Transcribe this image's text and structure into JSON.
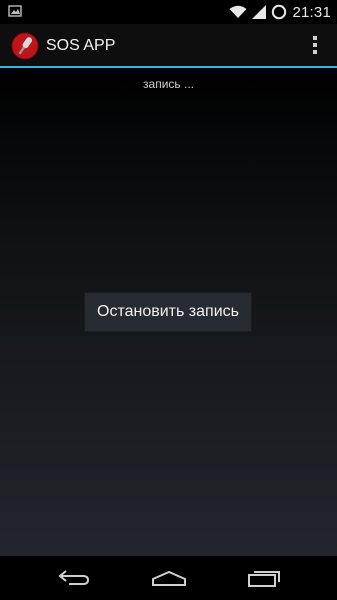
{
  "status_bar": {
    "time": "21:31",
    "icons": [
      "image-notification-icon",
      "wifi-icon",
      "signal-icon",
      "battery-icon"
    ]
  },
  "action_bar": {
    "title": "SOS APP",
    "app_icon": "microphone-icon",
    "overflow_icon": "overflow-menu-icon"
  },
  "main": {
    "status_text": "запись ...",
    "stop_button_label": "Остановить запись"
  },
  "nav_bar": {
    "buttons": [
      "back-icon",
      "home-icon",
      "recent-apps-icon"
    ]
  },
  "colors": {
    "accent": "#33b5e5",
    "app_icon_red": "#c0141b",
    "button_bg": "#262a31"
  }
}
